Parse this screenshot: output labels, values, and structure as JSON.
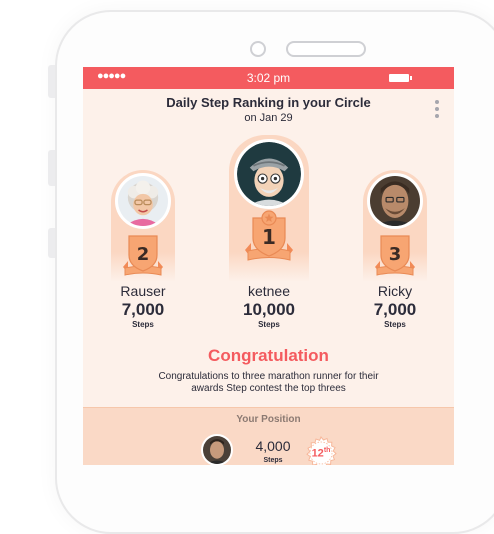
{
  "status_bar": {
    "signal": "●●●●●",
    "time": "3:02 pm"
  },
  "header": {
    "title": "Daily Step Ranking in your Circle",
    "date": "on Jan 29"
  },
  "podium": [
    {
      "rank": "2",
      "name": "Rauser",
      "steps": "7,000",
      "steps_label": "Steps"
    },
    {
      "rank": "1",
      "name": "ketnee",
      "steps": "10,000",
      "steps_label": "Steps"
    },
    {
      "rank": "3",
      "name": "Ricky",
      "steps": "7,000",
      "steps_label": "Steps"
    }
  ],
  "congrats": {
    "title": "Congratulation",
    "message": "Congratulations to three marathon runner for their awards Step contest the top threes"
  },
  "your_position": {
    "title": "Your Position",
    "steps": "4,000",
    "steps_label": "Steps",
    "rank": "12",
    "rank_suffix": "th"
  },
  "colors": {
    "accent": "#f45b5f",
    "badge": "#f7a572",
    "background": "#fdf1ea",
    "pillar": "#fbd7c2"
  }
}
